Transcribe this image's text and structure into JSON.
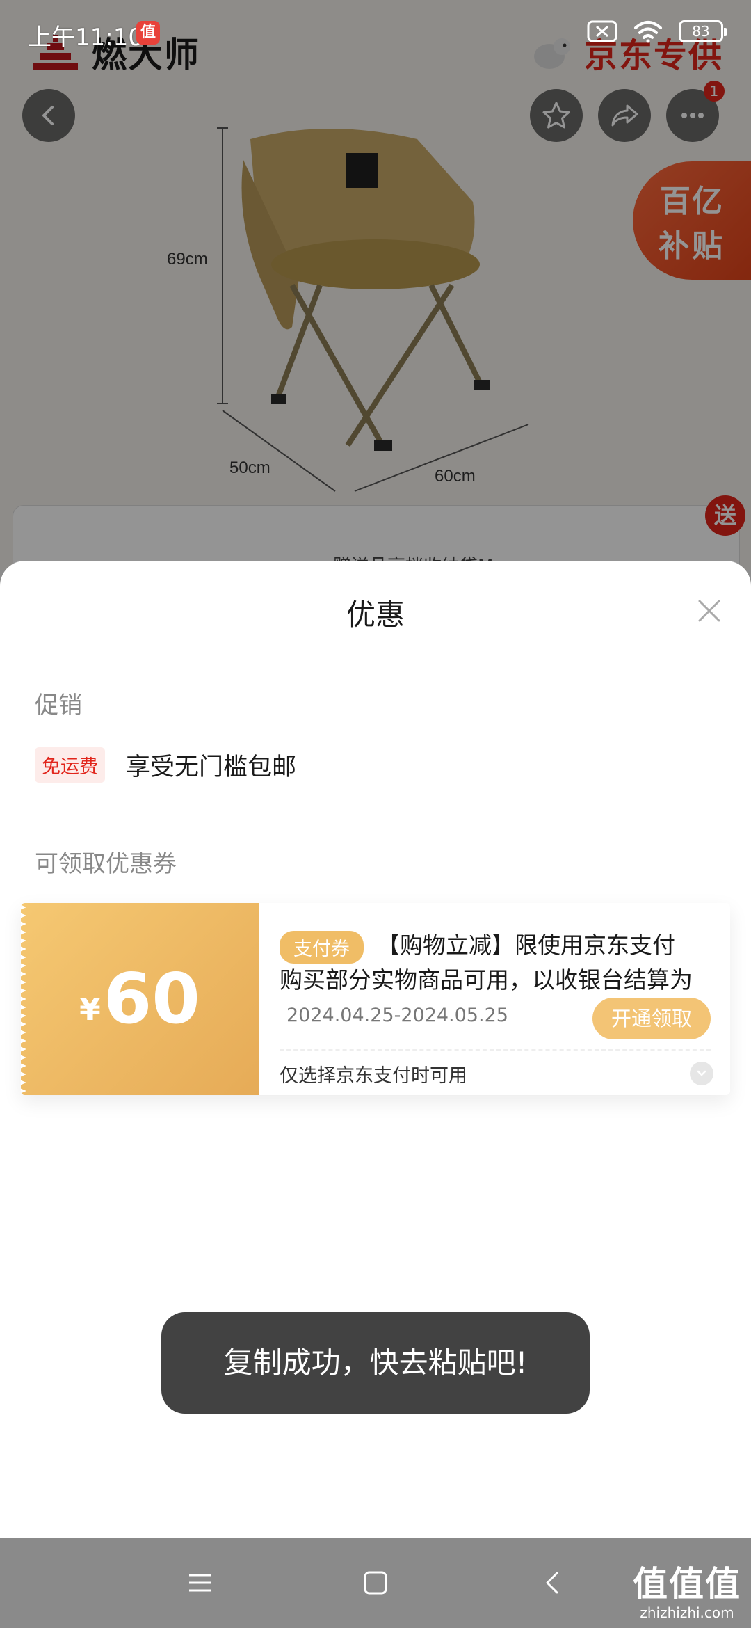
{
  "status_bar": {
    "time": "上午11:10",
    "app_icon_glyph": "值",
    "battery": "83"
  },
  "background_page": {
    "brand_left": "燃大师",
    "brand_right": "京东专供",
    "cart_count": "1",
    "product_dims": {
      "height": "69cm",
      "depth": "50cm",
      "width": "60cm"
    },
    "subsidy_line1": "百亿",
    "subsidy_line2": "补贴",
    "gift_badge": "送",
    "gift_text_partial": "赠送品高档收纳袋M"
  },
  "sheet": {
    "title": "优惠",
    "promo_section_label": "促销",
    "promo_tag": "免运费",
    "promo_desc": "享受无门槛包邮",
    "coupon_section_label": "可领取优惠券",
    "coupon": {
      "currency": "¥",
      "amount": "60",
      "type": "支付券",
      "description": "【购物立减】限使用京东支付购买部分实物商品可用，以收银台结算为准",
      "validity": "2024.04.25-2024.05.25",
      "action": "开通领取",
      "note": "仅选择京东支付时可用"
    }
  },
  "toast": {
    "message": "复制成功，快去粘贴吧!"
  },
  "watermark": {
    "main": "值值值",
    "sub": "zhizhizhi.com"
  },
  "colors": {
    "jd_red": "#e1251b",
    "coupon_gold": "#f0bd66",
    "toast_bg": "#323232"
  },
  "icons": {
    "back": "chevron-left-icon",
    "favorite": "star-icon",
    "share": "share-icon",
    "more": "more-dots-icon",
    "close": "close-icon",
    "expand": "chevron-down-icon",
    "nav_menu": "menu-icon",
    "nav_home": "home-square-icon",
    "nav_back": "back-triangle-icon"
  }
}
